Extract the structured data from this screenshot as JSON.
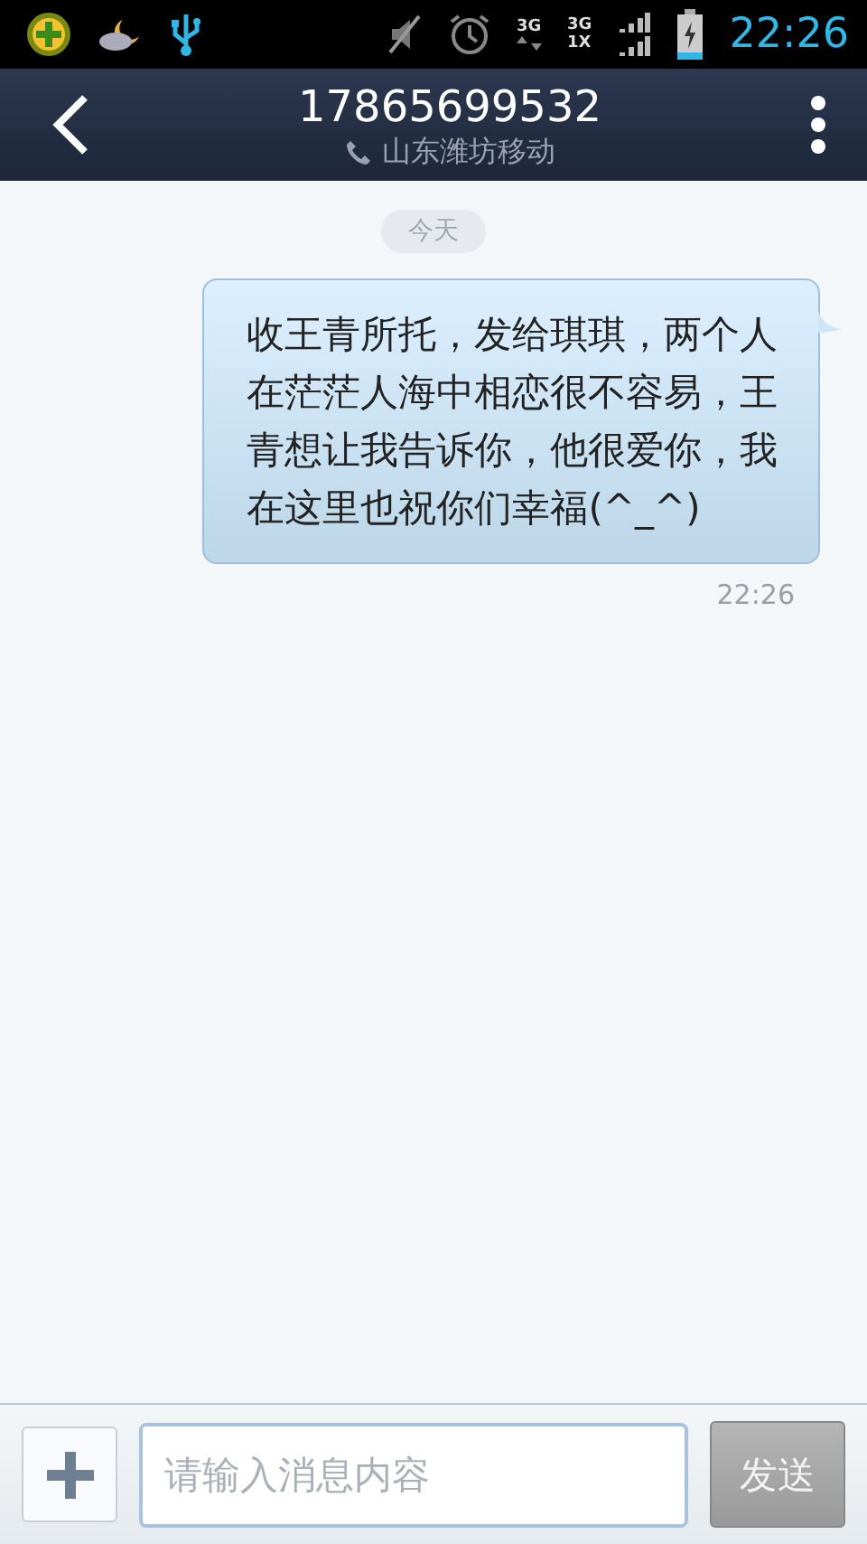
{
  "status_bar": {
    "network_top": "3G",
    "network_left": "3G",
    "network_bottom": "1X",
    "time": "22:26"
  },
  "header": {
    "title": "17865699532",
    "subtitle": "山东潍坊移动"
  },
  "date_divider": "今天",
  "messages": [
    {
      "text": "收王青所托，发给琪琪，两个人在茫茫人海中相恋很不容易，王青想让我告诉你，他很爱你，我在这里也祝你们幸福(^_^)",
      "time": "22:26",
      "kind": "sent"
    }
  ],
  "composer": {
    "placeholder": "请输入消息内容",
    "send_label": "发送",
    "send_disabled": true
  }
}
